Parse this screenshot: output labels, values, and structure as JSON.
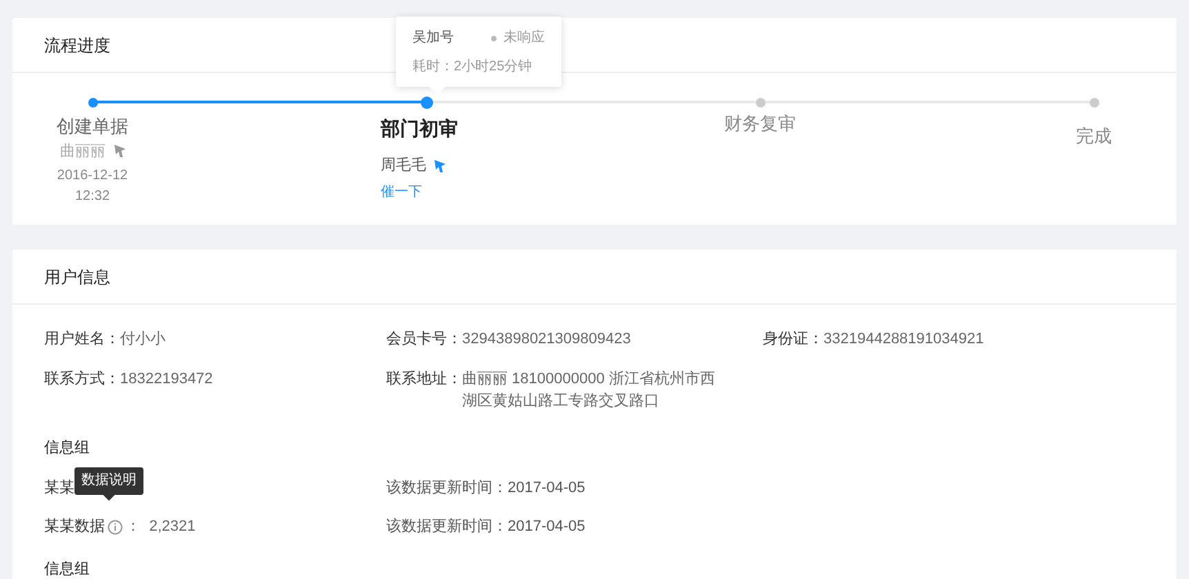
{
  "progress": {
    "title": "流程进度",
    "steps": [
      {
        "title": "创建单据",
        "done": true,
        "current": false,
        "person": "曲丽丽",
        "date": "2016-12-12",
        "time": "12:32"
      },
      {
        "title": "部门初审",
        "done": true,
        "current": true,
        "person": "周毛毛",
        "link": "催一下"
      },
      {
        "title": "财务复审",
        "done": false,
        "current": false
      },
      {
        "title": "完成",
        "done": false,
        "current": false
      }
    ],
    "popover": {
      "name": "吴加号",
      "status": "未响应",
      "duration": "耗时：2小时25分钟"
    }
  },
  "user_info": {
    "title": "用户信息",
    "fields": [
      {
        "label": "用户姓名：",
        "value": "付小小"
      },
      {
        "label": "会员卡号：",
        "value": "32943898021309809423"
      },
      {
        "label": "身份证：",
        "value": "3321944288191034921"
      },
      {
        "label": "联系方式：",
        "value": "18322193472"
      },
      {
        "label": "联系地址：",
        "value": "曲丽丽  18100000000  浙江省杭州市西湖区黄姑山路工专路交叉路口"
      }
    ],
    "groups": [
      {
        "title": "信息组",
        "rows": [
          {
            "label": "某某",
            "update": "该数据更新时间：2017-04-05",
            "tooltip": "数据说明"
          },
          {
            "label": "某某数据",
            "info": true,
            "value": "：  2,2321",
            "update": "该数据更新时间：2017-04-05"
          }
        ]
      },
      {
        "title": "信息组"
      }
    ]
  }
}
